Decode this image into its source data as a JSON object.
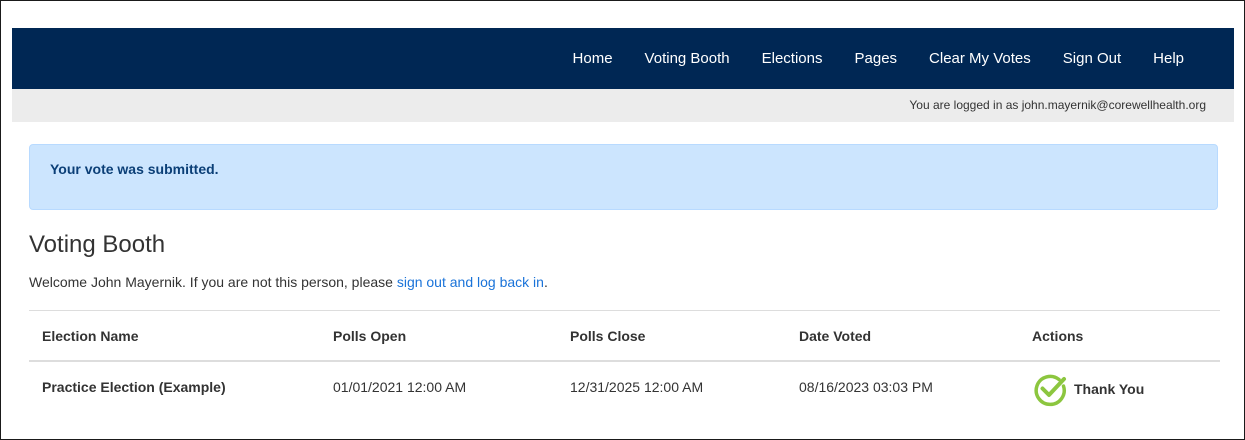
{
  "nav": {
    "links": [
      "Home",
      "Voting Booth",
      "Elections",
      "Pages",
      "Clear My Votes",
      "Sign Out",
      "Help"
    ]
  },
  "userbar": {
    "text": "You are logged in as john.mayernik@corewellhealth.org"
  },
  "alert": {
    "text": "Your vote was submitted."
  },
  "page": {
    "title": "Voting Booth",
    "welcome_prefix": "Welcome John Mayernik. If you are not this person, please ",
    "welcome_link": "sign out and log back in",
    "welcome_suffix": "."
  },
  "table": {
    "headers": [
      "Election Name",
      "Polls Open",
      "Polls Close",
      "Date Voted",
      "Actions"
    ],
    "rows": [
      {
        "election_name": "Practice Election (Example)",
        "polls_open": "01/01/2021 12:00 AM",
        "polls_close": "12/31/2025 12:00 AM",
        "date_voted": "08/16/2023 03:03 PM",
        "action_label": "Thank You",
        "action_icon": "check-circle-icon"
      }
    ]
  },
  "colors": {
    "navbar": "#002754",
    "alert_bg": "#cce5fe",
    "link": "#1a73d9",
    "check": "#8cc63f"
  }
}
